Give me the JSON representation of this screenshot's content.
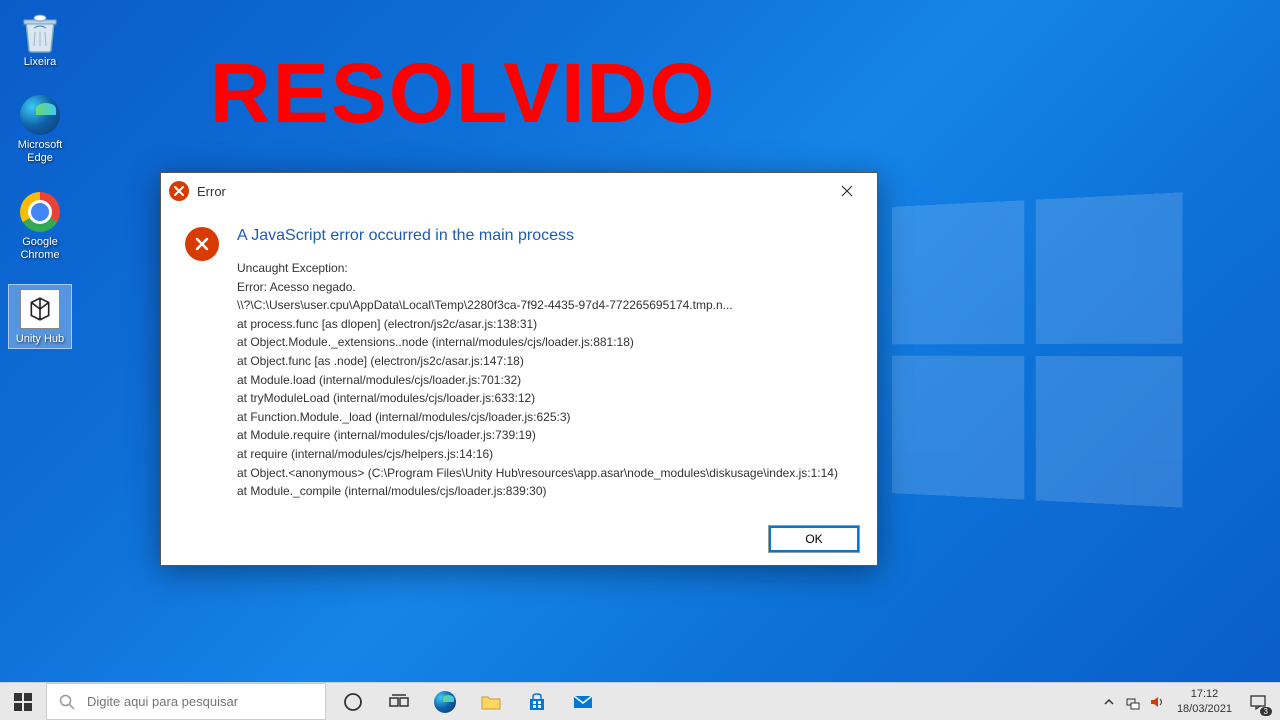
{
  "overlay": {
    "text": "RESOLVIDO"
  },
  "desktop_icons": [
    {
      "name": "recycle-bin",
      "label": "Lixeira"
    },
    {
      "name": "microsoft-edge",
      "label": "Microsoft Edge"
    },
    {
      "name": "google-chrome",
      "label": "Google Chrome"
    },
    {
      "name": "unity-hub",
      "label": "Unity Hub"
    }
  ],
  "dialog": {
    "title": "Error",
    "heading": "A JavaScript error occurred in the main process",
    "body": "Uncaught Exception:\nError: Acesso negado.\n\\\\?\\C:\\Users\\user.cpu\\AppData\\Local\\Temp\\2280f3ca-7f92-4435-97d4-772265695174.tmp.n...\n    at process.func [as dlopen] (electron/js2c/asar.js:138:31)\n    at Object.Module._extensions..node (internal/modules/cjs/loader.js:881:18)\n    at Object.func [as .node] (electron/js2c/asar.js:147:18)\n    at Module.load (internal/modules/cjs/loader.js:701:32)\n    at tryModuleLoad (internal/modules/cjs/loader.js:633:12)\n    at Function.Module._load (internal/modules/cjs/loader.js:625:3)\n    at Module.require (internal/modules/cjs/loader.js:739:19)\n    at require (internal/modules/cjs/helpers.js:14:16)\n    at Object.<anonymous> (C:\\Program Files\\Unity Hub\\resources\\app.asar\\node_modules\\diskusage\\index.js:1:14)\n    at Module._compile (internal/modules/cjs/loader.js:839:30)",
    "ok_label": "OK"
  },
  "taskbar": {
    "search_placeholder": "Digite aqui para pesquisar",
    "time": "17:12",
    "date": "18/03/2021",
    "notification_count": "3"
  }
}
